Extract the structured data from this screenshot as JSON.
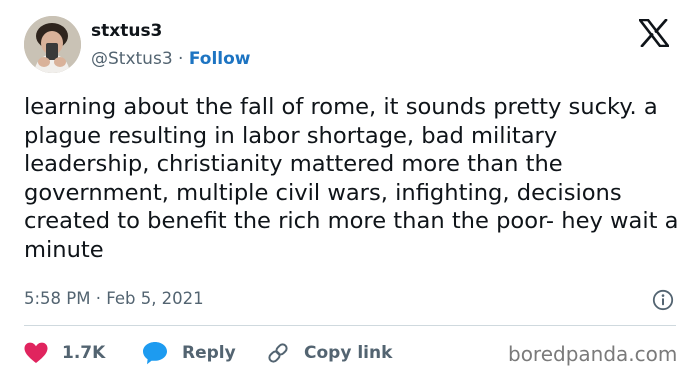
{
  "user": {
    "name": "stxtus3",
    "handle": "@Stxtus3",
    "separator": "·",
    "follow_label": "Follow"
  },
  "tweet": {
    "text": "learning about the fall of rome, it sounds pretty sucky. a plague resulting in labor shortage, bad military leadership, christianity mattered more than the government, multiple civil wars, infighting, decisions created to benefit the rich more than the poor- hey wait a minute",
    "time": "5:58 PM",
    "date_separator": "·",
    "date": "Feb 5, 2021"
  },
  "actions": {
    "like_count": "1.7K",
    "reply_label": "Reply",
    "copy_link_label": "Copy link"
  },
  "watermark": "boredpanda.com",
  "colors": {
    "like": "#e0245e",
    "reply": "#1d9bf0",
    "follow": "#1d74c2",
    "muted": "#536471"
  },
  "icons": [
    "x-logo-icon",
    "info-icon",
    "heart-icon",
    "speech-bubble-icon",
    "link-icon"
  ]
}
